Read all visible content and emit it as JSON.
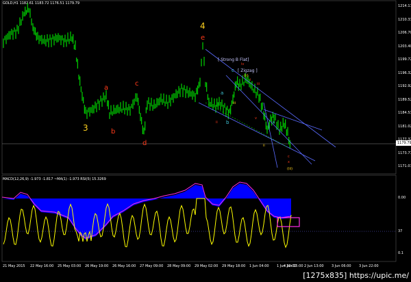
{
  "header": {
    "symbol_info": "GOLD,H1  1182.61 1183.72 1176.51 1179.79",
    "indicator_info": "MACD(12,26,9) -1.973 -1.817 ~MA(1) -1.973 RSI(5) 15.3269"
  },
  "price_axis": [
    "1214.17",
    "1210.33",
    "1206.70",
    "1203.40",
    "1199.72",
    "1196.32",
    "1192.92",
    "1189.52",
    "1184.53",
    "1181.02",
    "1177.32",
    "1173.77",
    "1171.07"
  ],
  "last_price": "1179.79",
  "indicator_axis": [
    "0.00",
    "37",
    "0.1"
  ],
  "time_axis": [
    "21 May 2015",
    "22 May 16:00",
    "25 May 03:00",
    "26 May 19:00",
    "26 May 16:00",
    "27 May 09:00",
    "28 May 09:00",
    "29 May 02:00",
    "29 May 18:00",
    "1 Jun 04:00",
    "1 Jun 20:00",
    "2 Jun 13:00",
    "3 Jun 06:00",
    "3 Jun 22:00",
    "4 Jun 15:00"
  ],
  "wave_labels": [
    {
      "id": "3",
      "text": "3",
      "color": "#ffd21f"
    },
    {
      "id": "4",
      "text": "4",
      "color": "#ffd21f"
    },
    {
      "id": "a",
      "text": "a",
      "color": "#ff3a1a"
    },
    {
      "id": "b",
      "text": "b",
      "color": "#ff3a1a"
    },
    {
      "id": "c",
      "text": "c",
      "color": "#ff3a1a"
    },
    {
      "id": "d",
      "text": "d",
      "color": "#ff3a1a"
    },
    {
      "id": "e",
      "text": "e",
      "color": "#ff3a1a"
    },
    {
      "id": "a2",
      "text": "a",
      "color": "#3fc6d8"
    },
    {
      "id": "b2",
      "text": "b",
      "color": "#3fc6d8"
    },
    {
      "id": "c2",
      "text": "c",
      "color": "#3fc6d8"
    }
  ],
  "annotations": [
    {
      "id": "strong",
      "text": "[ Strong B Flat]"
    },
    {
      "id": "zigzag",
      "text": "[ Zigzag ]"
    }
  ],
  "watermark": "[1275x835] https://upic.me/",
  "colors": {
    "candle": "#00d400",
    "macd_hist": "#0000ff",
    "signal": "#ff2be6",
    "rsi": "#ffff00",
    "wave_primary": "#ffd21f",
    "wave_minor": "#ff3a1a",
    "wave_sub": "#3fc6d8"
  }
}
